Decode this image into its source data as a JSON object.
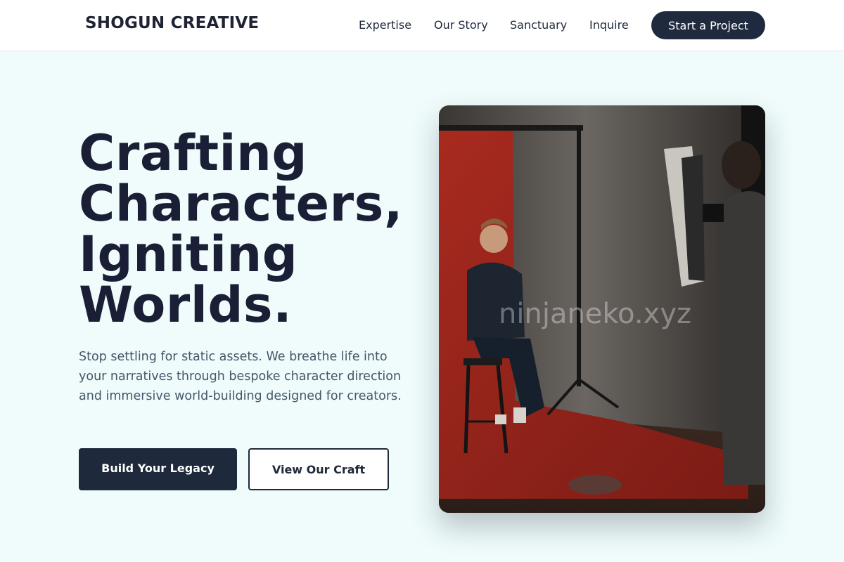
{
  "brand": "SHOGUN CREATIVE",
  "nav": {
    "links": [
      "Expertise",
      "Our Story",
      "Sanctuary",
      "Inquire"
    ],
    "cta": "Start a Project"
  },
  "hero": {
    "headline": [
      "Crafting",
      "Characters,",
      "Igniting",
      "Worlds."
    ],
    "description": "Stop settling for static assets. We breathe life into your narratives through bespoke character direction and immersive world-building designed for creators.",
    "primary_button": "Build Your Legacy",
    "secondary_button": "View Our Craft",
    "image_watermark": "ninjaneko.xyz"
  },
  "colors": {
    "background": "#effcfb",
    "primary": "#1e293b",
    "headline": "#1a1f35",
    "body_text": "#475569",
    "backdrop_red": "#b42e22"
  }
}
